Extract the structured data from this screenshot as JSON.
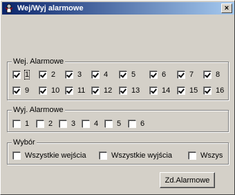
{
  "window": {
    "title": "Wej/Wyj alarmowe",
    "close_label": "×"
  },
  "inputs_group": {
    "label": "Wej. Alarmowe",
    "items": [
      {
        "label": "1",
        "checked": true
      },
      {
        "label": "2",
        "checked": true
      },
      {
        "label": "3",
        "checked": true
      },
      {
        "label": "4",
        "checked": true
      },
      {
        "label": "5",
        "checked": true
      },
      {
        "label": "6",
        "checked": true
      },
      {
        "label": "7",
        "checked": true
      },
      {
        "label": "8",
        "checked": true
      },
      {
        "label": "9",
        "checked": true
      },
      {
        "label": "10",
        "checked": true
      },
      {
        "label": "11",
        "checked": true
      },
      {
        "label": "12",
        "checked": true
      },
      {
        "label": "13",
        "checked": true
      },
      {
        "label": "14",
        "checked": true
      },
      {
        "label": "15",
        "checked": true
      },
      {
        "label": "16",
        "checked": true
      }
    ]
  },
  "outputs_group": {
    "label": "Wyj. Alarmowe",
    "items": [
      {
        "label": "1",
        "checked": false
      },
      {
        "label": "2",
        "checked": false
      },
      {
        "label": "3",
        "checked": false
      },
      {
        "label": "4",
        "checked": false
      },
      {
        "label": "5",
        "checked": false
      },
      {
        "label": "6",
        "checked": false
      }
    ]
  },
  "select_group": {
    "label": "Wybór",
    "items": [
      {
        "label": "Wszystkie wejścia",
        "checked": false
      },
      {
        "label": "Wszystkie wyjścia",
        "checked": false
      },
      {
        "label": "Wszys",
        "checked": false
      }
    ]
  },
  "button": {
    "label": "Zd.Alarmowe"
  }
}
